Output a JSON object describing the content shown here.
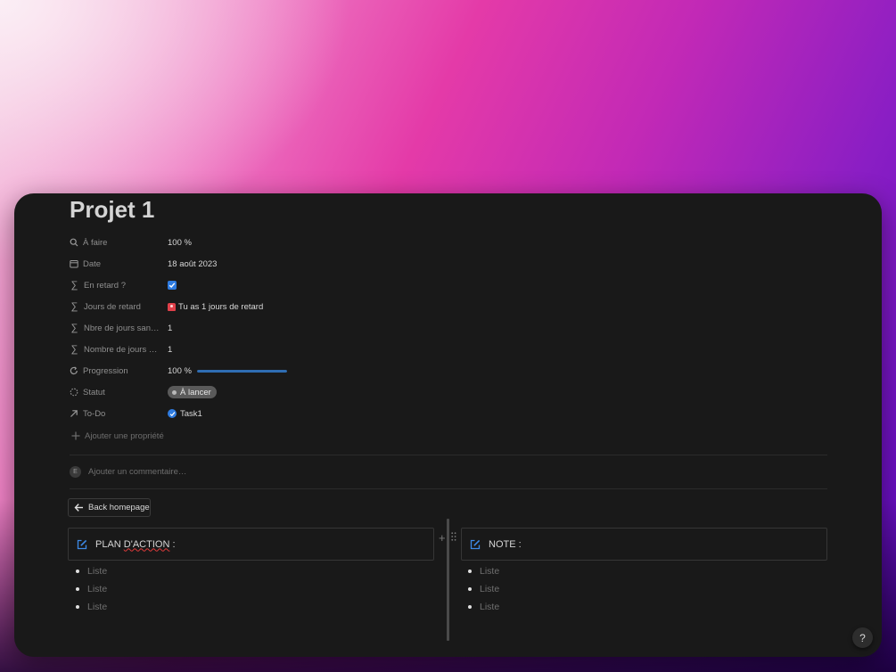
{
  "page": {
    "title": "Projet 1"
  },
  "properties": [
    {
      "icon": "search-icon",
      "name": "À faire",
      "value": "100 %"
    },
    {
      "icon": "calendar-icon",
      "name": "Date",
      "value": "18 août 2023"
    },
    {
      "icon": "sigma-icon",
      "name": "En retard ?",
      "checked": true
    },
    {
      "icon": "sigma-icon",
      "name": "Jours de retard",
      "value": "Tu as 1 jours de retard",
      "value_icon": "alarm-icon"
    },
    {
      "icon": "sigma-icon",
      "name": "Nbre de jours san…",
      "value": "1"
    },
    {
      "icon": "sigma-icon",
      "name": "Nombre de jours …",
      "value": "1"
    },
    {
      "icon": "progress-icon",
      "name": "Progression",
      "value": "100 %",
      "progress": 1.0
    },
    {
      "icon": "status-icon",
      "name": "Statut",
      "value": "À lancer"
    },
    {
      "icon": "relation-arrow-icon",
      "name": "To-Do",
      "value": "Task1"
    }
  ],
  "sigma_glyph": "∑",
  "add_property_label": "Ajouter une propriété",
  "comment": {
    "avatar": "E",
    "placeholder": "Ajouter un commentaire…"
  },
  "back_button": {
    "label": "Back homepage"
  },
  "columns": [
    {
      "heading_prefix": "PLAN ",
      "heading_underlined": "D'ACTION",
      "heading_suffix": " :",
      "items": [
        "Liste",
        "Liste",
        "Liste"
      ]
    },
    {
      "heading": "NOTE :",
      "items": [
        "Liste",
        "Liste",
        "Liste"
      ]
    }
  ],
  "help_button": {
    "label": "?"
  },
  "colors": {
    "accent": "#2e7be0",
    "progress": "#2f6db3",
    "background": "#191919"
  }
}
